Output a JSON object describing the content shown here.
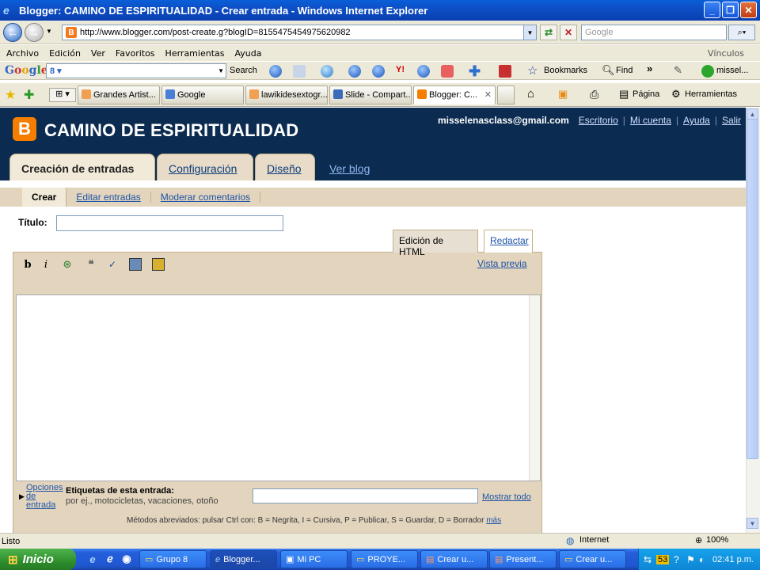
{
  "window": {
    "title": "Blogger: CAMINO DE ESPIRITUALIDAD - Crear entrada - Windows Internet Explorer"
  },
  "address_bar": {
    "url": "http://www.blogger.com/post-create.g?blogID=8155475454975620982",
    "search_placeholder": "Google"
  },
  "menu": {
    "items": [
      "Archivo",
      "Edición",
      "Ver",
      "Favoritos",
      "Herramientas",
      "Ayuda"
    ],
    "links_label": "Vínculos"
  },
  "google_toolbar": {
    "logo": "Google",
    "search_label": "Search",
    "bookmarks_label": "Bookmarks",
    "find_label": "Find",
    "user_label": "missel..."
  },
  "browser_tabs": [
    {
      "label": "Grandes Artist...",
      "icon_color": "#f0a050"
    },
    {
      "label": "Google",
      "icon_color": "#4a7fd8"
    },
    {
      "label": "lawikidesextogr...",
      "icon_color": "#f0a050"
    },
    {
      "label": "Slide - Compart...",
      "icon_color": "#3a6ab8"
    },
    {
      "label": "Blogger: C...",
      "icon_color": "#f57d00"
    }
  ],
  "command_bar": {
    "page_label": "Página",
    "tools_label": "Herramientas"
  },
  "blogger": {
    "blog_name": "CAMINO DE ESPIRITUALIDAD",
    "account_email": "misselenasclass@gmail.com",
    "account_links": [
      "Escritorio",
      "Mi cuenta",
      "Ayuda",
      "Salir"
    ],
    "main_tabs": [
      "Creación de entradas",
      "Configuración",
      "Diseño"
    ],
    "view_blog": "Ver blog",
    "sub_nav": [
      "Crear",
      "Editar entradas",
      "Moderar comentarios"
    ],
    "title_label": "Título:",
    "title_value": "",
    "editor_tabs": [
      "Edición de HTML",
      "Redactar"
    ],
    "preview_label": "Vista previa",
    "toolbar_icons": [
      "bold-icon",
      "italic-icon",
      "link-icon",
      "blockquote-icon",
      "spellcheck-icon",
      "image-icon",
      "video-icon"
    ],
    "bold_glyph": "b",
    "italic_glyph": "i",
    "post_body": "",
    "options_label": "Opciones de entrada",
    "tags_label": "Etiquetas de esta entrada:",
    "tags_hint": "por ej., motocicletas, vacaciones, otoño",
    "tags_value": "",
    "show_all": "Mostrar todo",
    "shortcuts_text": "Métodos abreviados: pulsar Ctrl con: B = Negrita, I = Cursiva, P = Publicar, S = Guardar, D = Borrador",
    "shortcuts_more": "más",
    "accent_color": "#f57d00",
    "header_color": "#0b2b50"
  },
  "status_bar": {
    "status": "Listo",
    "zone": "Internet",
    "zoom": "100%"
  },
  "taskbar": {
    "start_label": "Inicio",
    "buttons": [
      "Grupo 8",
      "Blogger...",
      "Mi PC",
      "PROYE...",
      "Crear u...",
      "Present...",
      "Crear u..."
    ],
    "clock": "02:41 p.m."
  }
}
